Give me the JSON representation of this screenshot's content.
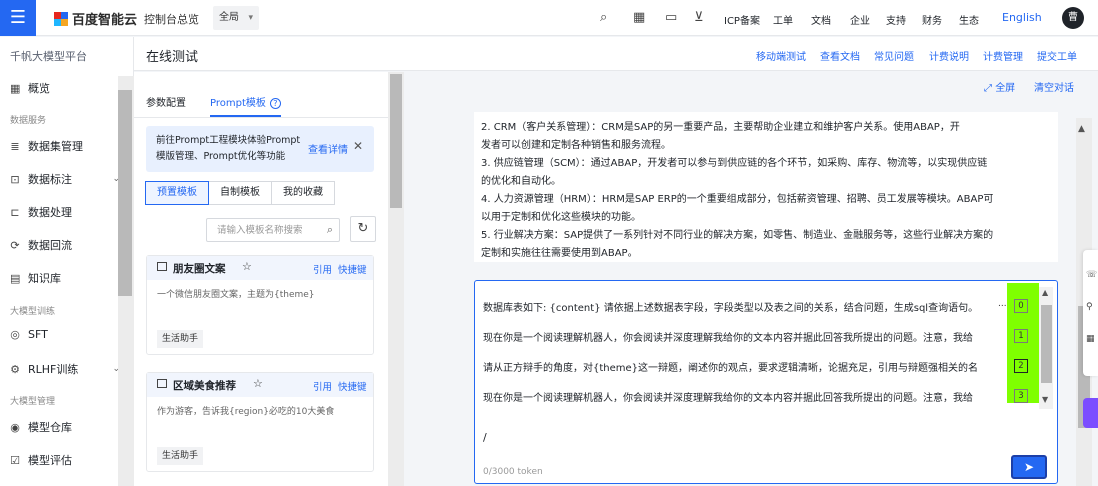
{
  "topbar": {
    "brand": "百度智能云",
    "console": "控制台总览",
    "region": "全局",
    "links": [
      "ICP备案",
      "工单",
      "文档",
      "企业",
      "支持",
      "财务",
      "生态"
    ],
    "language": "English",
    "avatar_text": "曹",
    "icons": [
      "search-icon",
      "grid-icon",
      "message-icon",
      "cart-icon"
    ],
    "brand_colors": [
      "#e6281e",
      "#2468f2",
      "#1fb6ff",
      "#f5a623"
    ]
  },
  "sidebar": {
    "title": "千帆大模型平台",
    "items": [
      {
        "label": "概览",
        "icon": "grid-icon"
      },
      {
        "group": "数据服务"
      },
      {
        "label": "数据集管理",
        "icon": "database-icon"
      },
      {
        "label": "数据标注",
        "icon": "tag-icon",
        "expandable": true
      },
      {
        "label": "数据处理",
        "icon": "process-icon"
      },
      {
        "label": "数据回流",
        "icon": "reflow-icon"
      },
      {
        "label": "知识库",
        "icon": "book-icon"
      },
      {
        "group": "大模型训练"
      },
      {
        "label": "SFT",
        "icon": "target-icon"
      },
      {
        "label": "RLHF训练",
        "icon": "gear-icon",
        "expandable": true
      },
      {
        "group": "大模型管理"
      },
      {
        "label": "模型仓库",
        "icon": "repo-icon"
      },
      {
        "label": "模型评估",
        "icon": "eval-icon"
      }
    ]
  },
  "header": {
    "title": "在线测试",
    "links": [
      "移动端测试",
      "查看文档",
      "常见问题",
      "计费说明",
      "计费管理",
      "提交工单"
    ]
  },
  "config": {
    "tabs": [
      "参数配置",
      "Prompt模板"
    ],
    "active_tab": "Prompt模板",
    "notice": {
      "text": "前往Prompt工程模块体验Prompt模版管理、Prompt优化等功能",
      "link": "查看详情"
    },
    "segments": [
      "预置模板",
      "自制模板",
      "我的收藏"
    ],
    "search_placeholder": "请输入模板名称搜索",
    "cards": [
      {
        "title": "朋友圈文案",
        "desc": "一个微信朋友圈文案，主题为{theme}",
        "tag": "生活助手",
        "use": "引用",
        "shortcut": "快捷键"
      },
      {
        "title": "区域美食推荐",
        "desc": "作为游客，告诉我{region}必吃的10大美食",
        "tag": "生活助手",
        "use": "引用",
        "shortcut": "快捷键"
      }
    ]
  },
  "chat": {
    "fullscreen": "全屏",
    "clear": "清空对话",
    "message_lines": [
      "2. CRM（客户关系管理）：CRM是SAP的另一重要产品，主要帮助企业建立和维护客户关系。使用ABAP，开",
      "发者可以创建和定制各种销售和服务流程。",
      "3. 供应链管理（SCM）：通过ABAP，开发者可以参与到供应链的各个环节，如采购、库存、物流等，以实现供应链",
      "的优化和自动化。",
      "4. 人力资源管理（HRM）：HRM是SAP ERP的一个重要组成部分，包括薪资管理、招聘、员工发展等模块。ABAP可",
      "以用于定制和优化这些模块的功能。",
      "5. 行业解决方案：SAP提供了一系列针对不同行业的解决方案，如零售、制造业、金融服务等，这些行业解决方案的",
      "定制和实施往往需要使用到ABAP。"
    ],
    "suggestions": [
      {
        "text": "数据库表如下: {content} 请依据上述数据表字段，字段类型以及表之间的关系，结合问题，生成sql查询语句。",
        "num": "0"
      },
      {
        "text": "现在你是一个阅读理解机器人，你会阅读并深度理解我给你的文本内容并据此回答我所提出的问题。注意，我给",
        "num": "1"
      },
      {
        "text": "请从正方辩手的角度，对{theme}这一辩题，阐述你的观点，要求逻辑清晰，论据充足，引用与辩题强相关的名",
        "num": "2"
      },
      {
        "text": "现在你是一个阅读理解机器人，你会阅读并深度理解我给你的文本内容并据此回答我所提出的问题。注意，我给",
        "num": "3"
      }
    ],
    "ellipsis": "...",
    "input_value": "/",
    "token_count": "0/3000 token",
    "highlight_color": "#7fff00"
  }
}
